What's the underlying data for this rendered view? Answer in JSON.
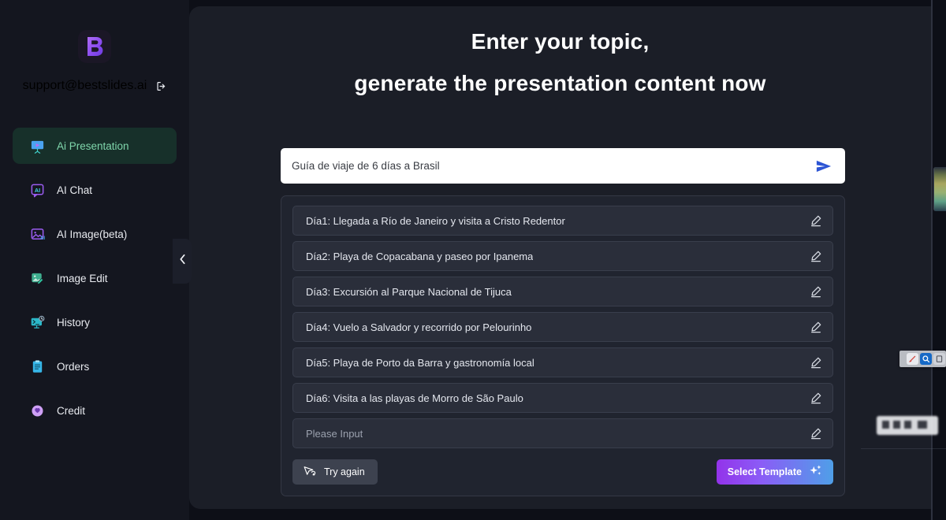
{
  "sidebar": {
    "logo": {
      "icon": "bestslides-b-logo",
      "letter": "B"
    },
    "account": {
      "email": "support@bestslides.ai",
      "logout_icon": "logout-icon"
    },
    "items": [
      {
        "label": "Ai Presentation",
        "icon": "presentation-icon",
        "active": true
      },
      {
        "label": "AI Chat",
        "icon": "ai-chat-icon",
        "active": false
      },
      {
        "label": "AI Image(beta)",
        "icon": "ai-image-icon",
        "active": false
      },
      {
        "label": "Image Edit",
        "icon": "image-edit-icon",
        "active": false
      },
      {
        "label": "History",
        "icon": "history-icon",
        "active": false
      },
      {
        "label": "Orders",
        "icon": "orders-icon",
        "active": false
      },
      {
        "label": "Credit",
        "icon": "credit-icon",
        "active": false
      }
    ],
    "collapse_icon": "chevron-left-icon"
  },
  "main": {
    "headline_line1": "Enter your topic,",
    "headline_line2": "generate the presentation content now",
    "search": {
      "value": "Guía de viaje de 6 días a Brasil",
      "placeholder": "Guía de viaje de 6 días a Brasil",
      "send_icon": "send-icon"
    },
    "outline": {
      "edit_icon": "pencil-edit-icon",
      "rows": [
        {
          "text": "Día1: Llegada a Río de Janeiro y visita a Cristo Redentor",
          "placeholder": false
        },
        {
          "text": "Día2: Playa de Copacabana y paseo por Ipanema",
          "placeholder": false
        },
        {
          "text": "Día3: Excursión al Parque Nacional de Tijuca",
          "placeholder": false
        },
        {
          "text": "Día4: Vuelo a Salvador y recorrido por Pelourinho",
          "placeholder": false
        },
        {
          "text": "Día5: Playa de Porto da Barra y gastronomía local",
          "placeholder": false
        },
        {
          "text": "Día6: Visita a las playas de Morro de São Paulo",
          "placeholder": false
        },
        {
          "text": "Please Input",
          "placeholder": true
        }
      ]
    },
    "actions": {
      "try_again_label": "Try again",
      "try_again_icon": "retry-cursor-icon",
      "select_template_label": "Select Template",
      "select_template_icon": "sparkles-icon"
    }
  },
  "colors": {
    "app_background": "#0d0f17",
    "sidebar_background": "#14161f",
    "main_background": "#1b1e27",
    "panel_background": "#20242f",
    "row_background": "#2a2e3a",
    "active_nav_background": "#17302a",
    "active_nav_text": "#7fd6ab",
    "accent_purple": "#9333ea",
    "accent_blue": "#4f9fe8",
    "send_blue": "#2d55d4"
  }
}
